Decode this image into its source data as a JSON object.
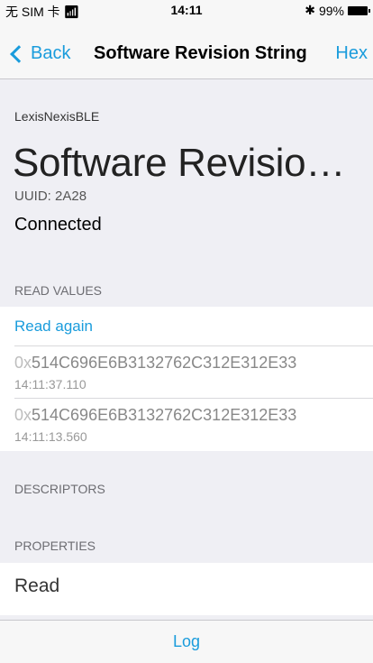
{
  "status": {
    "carrier": "无 SIM 卡",
    "wifi": "wifi",
    "time": "14:11",
    "bluetooth": "✱",
    "battery": "99%"
  },
  "nav": {
    "back_label": "Back",
    "title": "Software Revision String",
    "hex_label": "Hex"
  },
  "device": {
    "name": "LexisNexisBLE"
  },
  "characteristic": {
    "title": "Software Revision Str…",
    "uuid": "UUID: 2A28",
    "state": "Connected"
  },
  "read_values": {
    "header": "READ VALUES",
    "read_again": "Read again",
    "items": [
      {
        "prefix": "0x",
        "value": "514C696E6B3132762C312E312E33",
        "time": "14:11:37.110"
      },
      {
        "prefix": "0x",
        "value": "514C696E6B3132762C312E312E33",
        "time": "14:11:13.560"
      }
    ]
  },
  "descriptors": {
    "header": "DESCRIPTORS"
  },
  "properties": {
    "header": "PROPERTIES",
    "items": [
      "Read"
    ]
  },
  "tabbar": {
    "log_label": "Log"
  },
  "colors": {
    "accent": "#1a9cdc",
    "background": "#efeff4"
  }
}
